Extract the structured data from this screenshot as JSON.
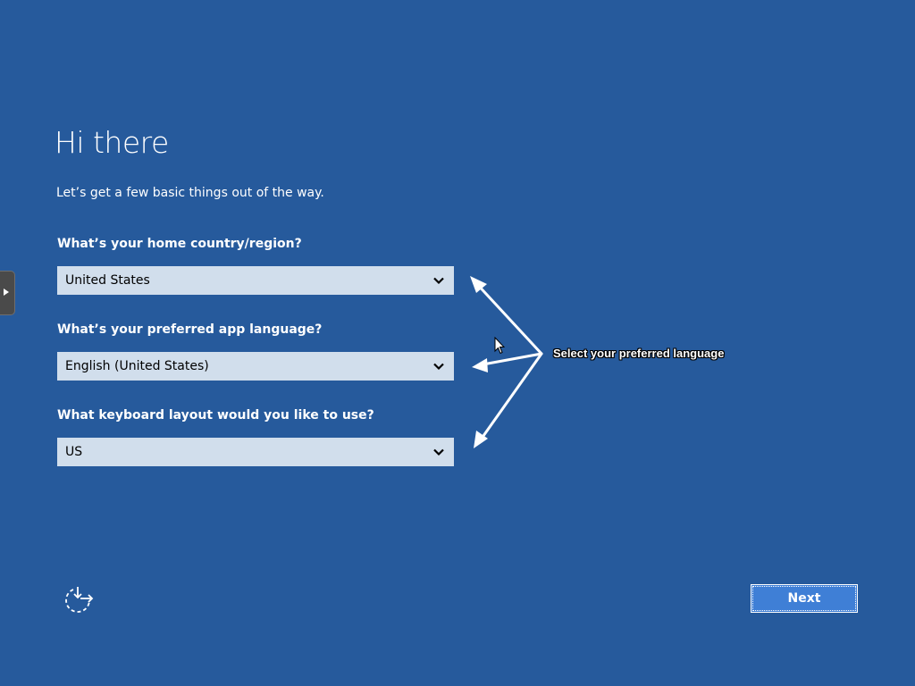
{
  "header": {
    "title": "Hi there",
    "subtitle": "Let’s get a few basic things out of the way."
  },
  "form": {
    "country": {
      "question": "What’s your home country/region?",
      "value": "United States"
    },
    "app_language": {
      "question": "What’s your preferred app language?",
      "value": "English (United States)"
    },
    "keyboard": {
      "question": "What keyboard layout would you like to use?",
      "value": "US"
    }
  },
  "annotation": {
    "label": "Select your preferred language"
  },
  "footer": {
    "accessibility_icon": "ease-of-access-icon",
    "next_label": "Next"
  },
  "colors": {
    "background": "#265a9c",
    "dropdown_bg": "#d1deec",
    "next_button_bg": "#3f7fd6"
  }
}
